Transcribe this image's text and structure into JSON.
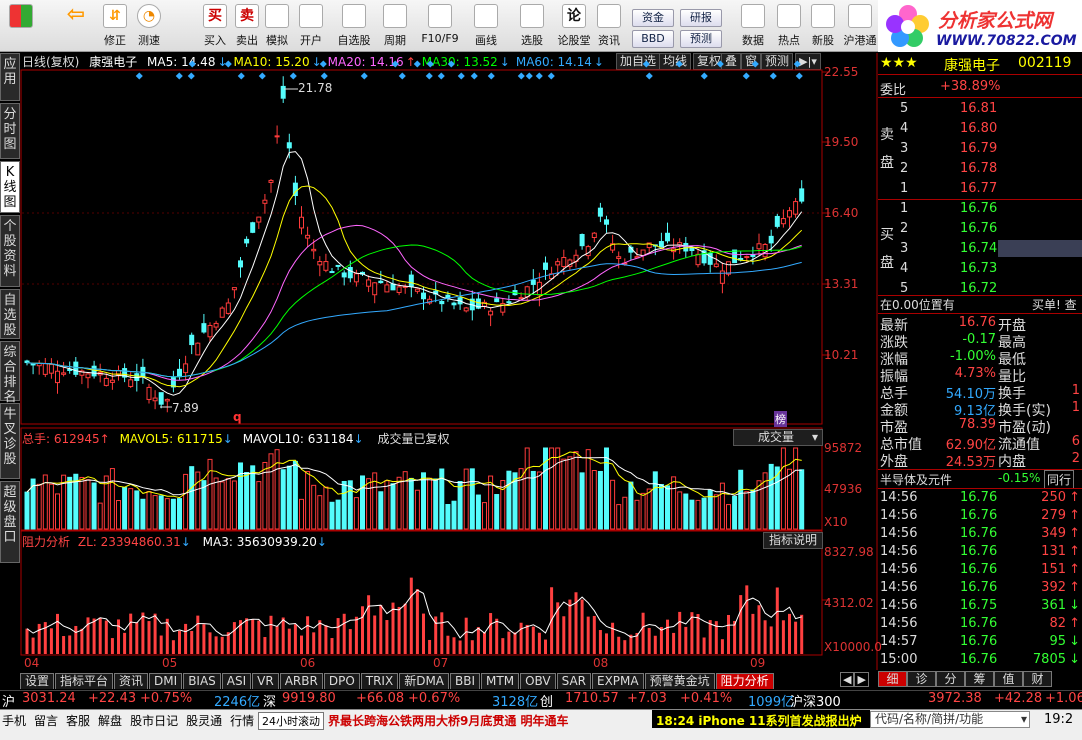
{
  "toolbar": {
    "buttons": [
      {
        "label": "",
        "icon": "windows-grid-icon"
      },
      {
        "label": "",
        "icon": "back-arrow-icon"
      },
      {
        "label": "修正",
        "icon": "up-down-icon"
      },
      {
        "label": "测速",
        "icon": "speed-icon"
      },
      {
        "label": "测速",
        "icon": "clock-icon"
      },
      {
        "label": "买入",
        "icon": "buy-icon",
        "glyph": "买"
      },
      {
        "label": "卖出",
        "icon": "sell-icon",
        "glyph": "卖"
      },
      {
        "label": "模拟",
        "icon": "hammer-icon"
      },
      {
        "label": "开户",
        "icon": "lock-icon"
      },
      {
        "label": "自选股",
        "icon": "star-icon"
      },
      {
        "label": "周期",
        "icon": "period-icon"
      },
      {
        "label": "F10/F9",
        "icon": "f10-icon"
      },
      {
        "label": "画线",
        "icon": "pen-icon"
      },
      {
        "label": "选股",
        "icon": "select-icon"
      },
      {
        "label": "论股堂",
        "icon": "forum-icon",
        "glyph": "论"
      },
      {
        "label": "资讯",
        "icon": "news-icon"
      },
      {
        "label": "数据",
        "icon": "data-icon"
      },
      {
        "label": "热点",
        "icon": "hot-icon"
      },
      {
        "label": "新股",
        "icon": "ipo-icon"
      },
      {
        "label": "沪港通",
        "icon": "hk-connect-icon"
      }
    ],
    "small_buttons": [
      "资金",
      "研报",
      "BBD",
      "预测"
    ]
  },
  "logo": {
    "title": "分析家公式网",
    "url": "WWW.70822.COM"
  },
  "side_tabs": [
    {
      "label": "应用"
    },
    {
      "label": "分时图"
    },
    {
      "label": "K线图"
    },
    {
      "label": "个股资料"
    },
    {
      "label": "自选股"
    },
    {
      "label": "综合排名"
    },
    {
      "label": "牛叉诊股"
    },
    {
      "label": "超级盘口"
    }
  ],
  "main_chart": {
    "period": "日线(复权)",
    "name": "康强电子",
    "ma": [
      {
        "label": "MA5: 14.48",
        "color": "#ffffff"
      },
      {
        "label": "MA10: 15.20",
        "color": "#ffff00"
      },
      {
        "label": "MA20: 14.16",
        "color": "#ff66ff"
      },
      {
        "label": "MA30: 13.52",
        "color": "#00ff00"
      },
      {
        "label": "MA60: 14.14",
        "color": "#33aaff"
      }
    ],
    "buttons": [
      "加自选",
      "均线",
      "复权",
      "叠",
      "窗",
      "预测"
    ],
    "price_labels": [
      "22.55",
      "19.50",
      "16.40",
      "13.31",
      "10.21"
    ],
    "high_label": "21.78",
    "low_label": "7.89",
    "marker_q": "q",
    "marker_bang": "榜"
  },
  "volume_panel": {
    "total": "总手: 612945",
    "mavol5": "MAVOL5: 611715",
    "mavol10": "MAVOL10: 631184",
    "note": "成交量已复权",
    "select": "成交量",
    "labels": [
      "95872",
      "47936",
      "X10"
    ]
  },
  "indicator_panel": {
    "name": "阻力分析",
    "zl": "ZL: 23394860.31",
    "ma3": "MA3: 35630939.20",
    "help": "指标说明",
    "labels": [
      "8327.98",
      "4312.02",
      "X10000.0"
    ]
  },
  "dates": [
    "04",
    "05",
    "06",
    "07",
    "08",
    "09"
  ],
  "quote": {
    "stars": "★★★",
    "name": "康强电子",
    "code": "002119",
    "weibi_label": "委比",
    "weibi_value": "+38.89%",
    "sell_label": "卖盘",
    "buy_label": "买盘",
    "sell": [
      {
        "lvl": "5",
        "price": "16.81",
        "vol": ""
      },
      {
        "lvl": "4",
        "price": "16.80",
        "vol": ""
      },
      {
        "lvl": "3",
        "price": "16.79",
        "vol": ""
      },
      {
        "lvl": "2",
        "price": "16.78",
        "vol": ""
      },
      {
        "lvl": "1",
        "price": "16.77",
        "vol": ""
      }
    ],
    "buy": [
      {
        "lvl": "1",
        "price": "16.76",
        "vol": ""
      },
      {
        "lvl": "2",
        "price": "16.76",
        "vol": ""
      },
      {
        "lvl": "3",
        "price": "16.74",
        "vol": ""
      },
      {
        "lvl": "4",
        "price": "16.73",
        "vol": ""
      },
      {
        "lvl": "5",
        "price": "16.72",
        "vol": ""
      }
    ],
    "position_text": "在0.00位置有",
    "buy_hint": "买单! 查",
    "stats": [
      {
        "k": "最新",
        "v": "16.76",
        "k2": "开盘",
        "v2": ""
      },
      {
        "k": "涨跌",
        "v": "-0.17",
        "k2": "最高",
        "v2": ""
      },
      {
        "k": "涨幅",
        "v": "-1.00%",
        "k2": "最低",
        "v2": ""
      },
      {
        "k": "振幅",
        "v": "4.73%",
        "k2": "量比",
        "v2": ""
      },
      {
        "k": "总手",
        "v": "54.10万",
        "k2": "换手",
        "v2": "1"
      },
      {
        "k": "金额",
        "v": "9.13亿",
        "k2": "换手(实)",
        "v2": "1"
      },
      {
        "k": "市盈",
        "v": "78.39",
        "k2": "市盈(动)",
        "v2": ""
      },
      {
        "k": "总市值",
        "v": "62.90亿",
        "k2": "流通值",
        "v2": "6"
      },
      {
        "k": "外盘",
        "v": "24.53万",
        "k2": "内盘",
        "v2": "2"
      }
    ],
    "sector": "半导体及元件",
    "sector_change": "-0.15%",
    "sector_btn": "同行",
    "ticks": [
      {
        "t": "14:56",
        "p": "16.76",
        "v": "250",
        "d": "up"
      },
      {
        "t": "14:56",
        "p": "16.76",
        "v": "279",
        "d": "up"
      },
      {
        "t": "14:56",
        "p": "16.76",
        "v": "349",
        "d": "up"
      },
      {
        "t": "14:56",
        "p": "16.76",
        "v": "131",
        "d": "up"
      },
      {
        "t": "14:56",
        "p": "16.76",
        "v": "151",
        "d": "up"
      },
      {
        "t": "14:56",
        "p": "16.76",
        "v": "392",
        "d": "up"
      },
      {
        "t": "14:56",
        "p": "16.75",
        "v": "361",
        "d": "down"
      },
      {
        "t": "14:56",
        "p": "16.76",
        "v": "82",
        "d": "up"
      },
      {
        "t": "14:57",
        "p": "16.76",
        "v": "95",
        "d": "down"
      },
      {
        "t": "15:00",
        "p": "16.76",
        "v": "7805",
        "d": "down"
      }
    ],
    "bottom_tabs": [
      "细",
      "诊",
      "分",
      "筹",
      "值",
      "财"
    ]
  },
  "bottom_tabs": [
    "设置",
    "指标平台",
    "资讯",
    "DMI",
    "BIAS",
    "ASI",
    "VR",
    "ARBR",
    "DPO",
    "TRIX",
    "新DMA",
    "BBI",
    "MTM",
    "OBV",
    "SAR",
    "EXPMA",
    "预警黄金坑",
    "阻力分析"
  ],
  "index_bar": {
    "sh_label": "沪",
    "sh": "3031.24",
    "sh_chg": "+22.43",
    "sh_pct": "+0.75%",
    "sh_amt": "2246亿",
    "sz_label": "深",
    "sz": "9919.80",
    "sz_chg": "+66.08",
    "sz_pct": "+0.67%",
    "sz_amt": "3128亿",
    "cy_label": "创",
    "cy": "1710.57",
    "cy_chg": "+7.03",
    "cy_pct": "+0.41%",
    "cy_amt": "1099亿",
    "hs_label": "沪深300",
    "hs": "3972.38",
    "hs_chg": "+42.28",
    "hs_pct": "+1.06"
  },
  "status_bar": {
    "items": [
      "手机",
      "留言",
      "客服",
      "解盘",
      "股市日记",
      "股灵通",
      "行情"
    ],
    "news_btn": "24小时滚动",
    "news": "界最长跨海公铁两用大桥9月底贯通 明年通车",
    "news2": "18:24 iPhone 11系列首发战报出炉",
    "search_placeholder": "代码/名称/简拼/功能",
    "time": "19:2"
  }
}
